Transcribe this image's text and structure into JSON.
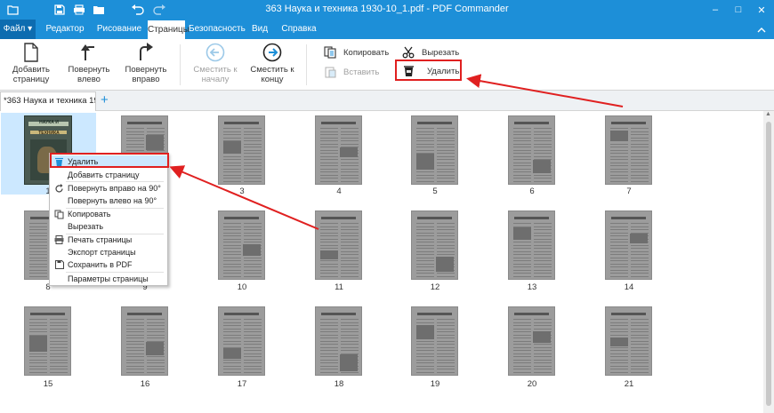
{
  "window": {
    "title": "363 Наука и техника 1930-10_1.pdf - PDF Commander",
    "controls": {
      "minimize": "–",
      "maximize": "□",
      "close": "✕"
    }
  },
  "quick_access": {
    "icons": [
      "open-folder-icon",
      "save-icon",
      "print-icon",
      "folder-icon",
      "undo-icon",
      "redo-icon"
    ]
  },
  "menu": {
    "file": "Файл ▾",
    "tabs": [
      "Редактор",
      "Рисование",
      "Страницы",
      "Безопасность",
      "Вид",
      "Справка"
    ],
    "active_tab": "Страницы"
  },
  "ribbon": {
    "add_page": {
      "line1": "Добавить",
      "line2": "страницу"
    },
    "rotate_left": {
      "line1": "Повернуть",
      "line2": "влево"
    },
    "rotate_right": {
      "line1": "Повернуть",
      "line2": "вправо"
    },
    "move_start": {
      "line1": "Сместить к",
      "line2": "началу"
    },
    "move_end": {
      "line1": "Сместить к",
      "line2": "концу"
    },
    "copy": "Копировать",
    "paste": "Вставить",
    "cut": "Вырезать",
    "delete": "Удалить"
  },
  "doc_tab": {
    "label": "*363 Наука и техника 19...",
    "add": "+"
  },
  "cover_text": {
    "line1": "НАУКА И",
    "line2": "ТЕХНИКА"
  },
  "pages": [
    "1",
    "2",
    "3",
    "4",
    "5",
    "6",
    "7",
    "8",
    "9",
    "10",
    "11",
    "12",
    "13",
    "14",
    "15",
    "16",
    "17",
    "18",
    "19",
    "20",
    "21"
  ],
  "selected_page": "1",
  "context_menu": {
    "delete": "Удалить",
    "add_page": "Добавить страницу",
    "rotate_right": "Повернуть вправо на 90°",
    "rotate_left": "Повернуть влево на 90°",
    "copy": "Копировать",
    "cut": "Вырезать",
    "print": "Печать страницы",
    "export": "Экспорт страницы",
    "save_pdf": "Сохранить в PDF",
    "page_params": "Параметры страницы"
  },
  "colors": {
    "accent": "#1d8fd8",
    "highlight": "#e02020",
    "selection": "#cce8ff"
  }
}
